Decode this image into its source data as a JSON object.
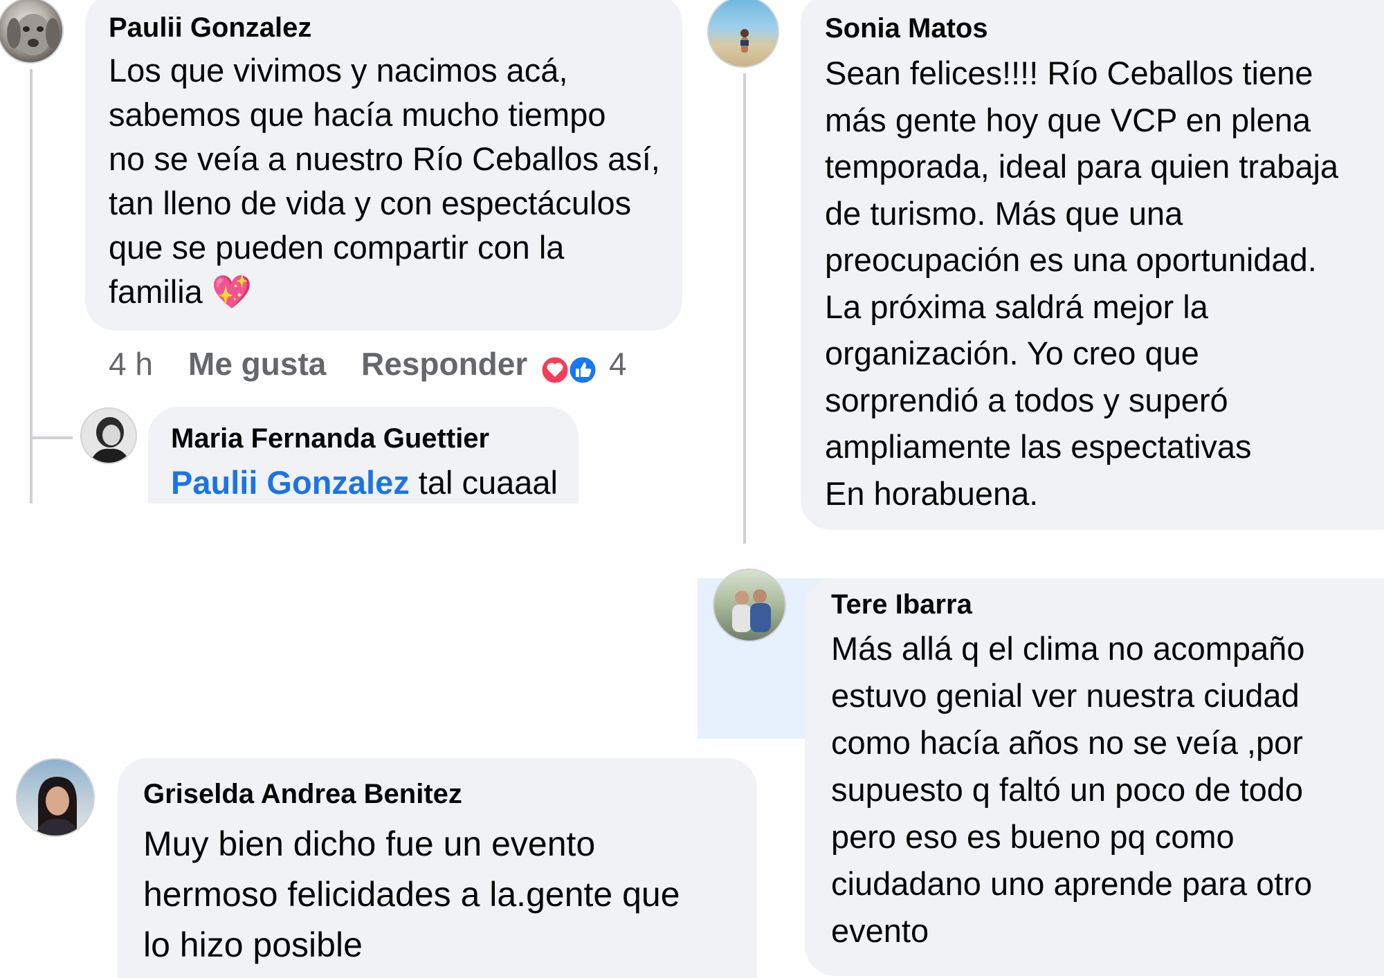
{
  "comments": {
    "paulii": {
      "author": "Paulii Gonzalez",
      "text": "Los que vivimos y nacimos acá,\nsabemos que hacía mucho tiempo\nno se veía a nuestro Río Ceballos así,\ntan lleno de vida y con espectáculos\nque se pueden compartir con la\nfamilia",
      "emoji": "💖",
      "time": "4 h",
      "like_label": "Me gusta",
      "reply_label": "Responder",
      "reaction_count": "4",
      "reactions": [
        "heart-reaction-icon",
        "like-reaction-icon"
      ]
    },
    "maria": {
      "author": "Maria Fernanda Guettier",
      "mention": "Paulii Gonzalez",
      "text": " tal cuaaal"
    },
    "sonia": {
      "author": "Sonia Matos",
      "text": "Sean felices!!!! Río Ceballos tiene\nmás gente hoy que VCP en plena\ntemporada, ideal para quien trabaja\nde turismo. Más que una\npreocupación es una oportunidad.\nLa próxima saldrá mejor la\norganización. Yo creo que\nsorprendió a todos y superó\nampliamente las espectativas\n En horabuena."
    },
    "tere": {
      "author": "Tere Ibarra",
      "text": "Más allá q el clima no acompaño\nestuvo genial ver nuestra ciudad\ncomo hacía años no se veía ,por\nsupuesto q faltó un poco de todo\npero eso es bueno pq como\nciudadano uno aprende para otro\nevento"
    },
    "griselda": {
      "author": "Griselda Andrea Benitez",
      "text": "Muy bien dicho fue un evento\nhermoso felicidades a la.gente que\nlo hizo posible"
    }
  },
  "colors": {
    "bubble": "#f0f2f5",
    "text": "#050505",
    "meta": "#65676b",
    "mention": "#1b74e4",
    "highlight": "#e7f0fd",
    "heart": "#f33e58",
    "like": "#1877f2"
  }
}
